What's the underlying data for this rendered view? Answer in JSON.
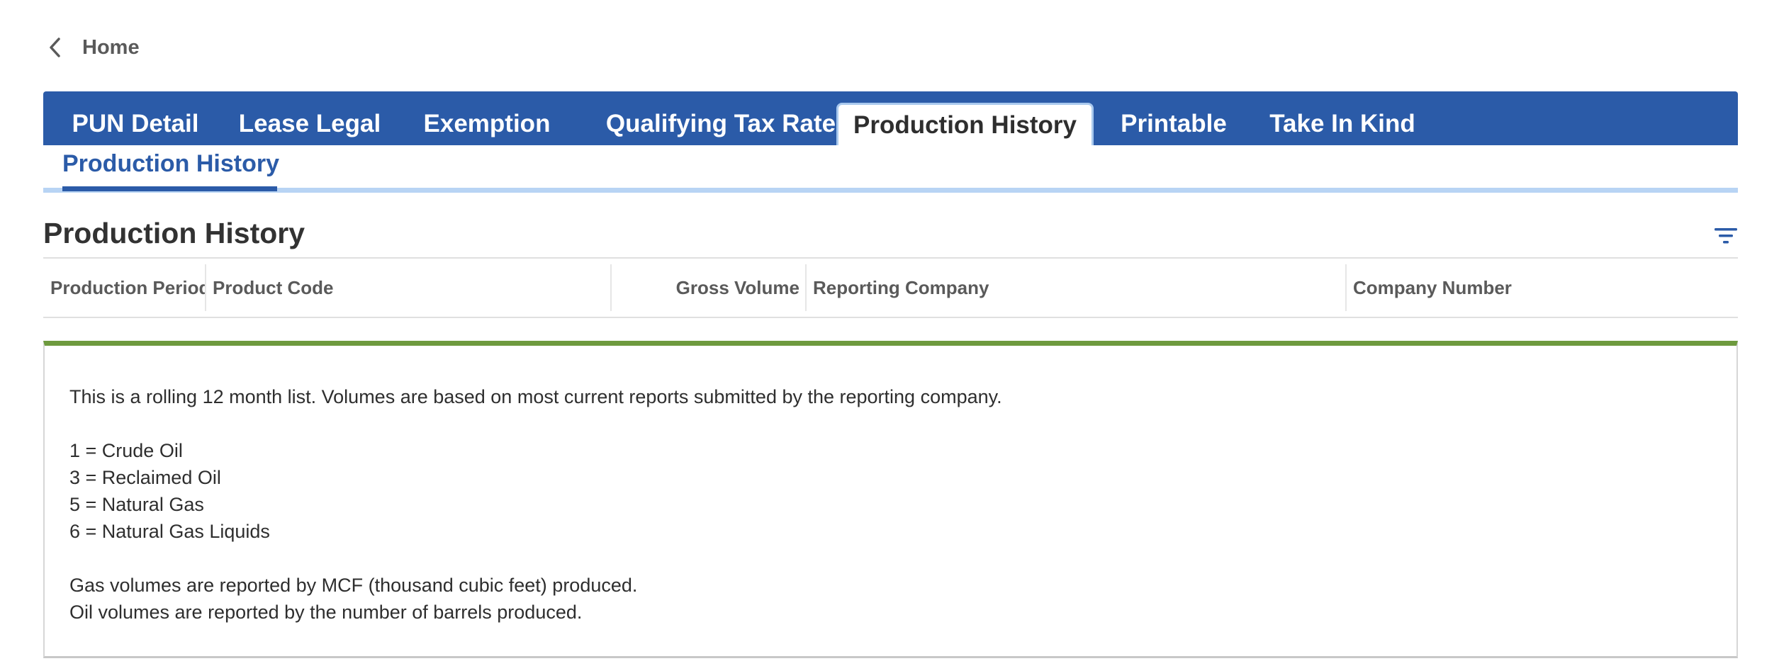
{
  "nav": {
    "back_label": "Home"
  },
  "tabs": [
    {
      "label": "PUN Detail"
    },
    {
      "label": "Lease Legal"
    },
    {
      "label": "Exemption"
    },
    {
      "label": "Qualifying Tax Rate"
    },
    {
      "label": "Production History"
    },
    {
      "label": "Printable"
    },
    {
      "label": "Take In Kind"
    }
  ],
  "active_tab": "Production History",
  "subtab": {
    "label": "Production History"
  },
  "section": {
    "title": "Production History",
    "filter_icon": "filter-icon"
  },
  "table": {
    "columns": [
      {
        "label": "Production Period"
      },
      {
        "label": "Product Code"
      },
      {
        "label": "Gross Volume"
      },
      {
        "label": "Reporting Company"
      },
      {
        "label": "Company Number"
      }
    ],
    "rows": []
  },
  "info": {
    "intro": "This is a rolling 12 month list. Volumes are based on most current reports submitted by the reporting company.",
    "codes": [
      "1 = Crude Oil",
      "3 = Reclaimed Oil",
      "5 = Natural Gas",
      "6 = Natural Gas Liquids"
    ],
    "notes": [
      "Gas volumes are reported by MCF (thousand cubic feet) produced.",
      "Oil volumes are reported by the number of barrels produced."
    ]
  },
  "colors": {
    "brand_blue": "#2b5ba8",
    "light_blue": "#b8d4f4",
    "accent_green": "#6e9a3e"
  }
}
